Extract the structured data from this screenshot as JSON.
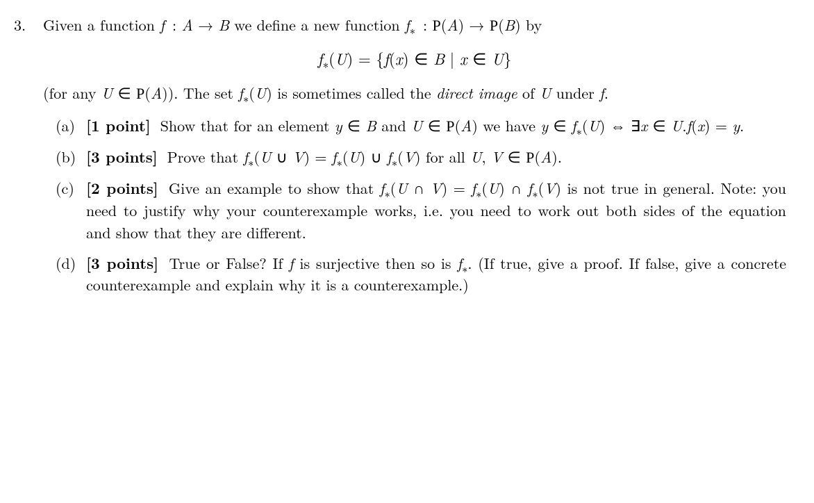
{
  "problem": {
    "number": "3.",
    "intro_html": "Given a function <span class='it'>f</span>&nbsp;: <span class='it'>A</span> → <span class='it'>B</span> we define a new function <span class='it'>f</span><span class='sub'>∗</span>&nbsp;: <span class='cal'>P</span>(<span class='it'>A</span>) → <span class='cal'>P</span>(<span class='it'>B</span>) by",
    "display_html": "<span class='it'>f</span><span class='sub'>∗</span>(<span class='it'>U</span>) = {<span class='it'>f</span>(<span class='it'>x</span>) ∈ <span class='it'>B</span> | <span class='it'>x</span> ∈ <span class='it'>U</span>}",
    "after_html": "(for any <span class='it'>U</span> ∈ <span class='cal'>P</span>(<span class='it'>A</span>)). The set <span class='it'>f</span><span class='sub'>∗</span>(<span class='it'>U</span>) is sometimes called the <span class='it'>direct image</span> of <span class='it'>U</span> under <span class='it'>f</span>.",
    "parts": [
      {
        "label": "(a)",
        "points": "[1 point]",
        "text_html": "Show that for an element <span class='it'>y</span> ∈ <span class='it'>B</span> and <span class='it'>U</span> ∈ <span class='cal'>P</span>(<span class='it'>A</span>) we have <span class='it'>y</span> ∈ <span class='it'>f</span><span class='sub'>∗</span>(<span class='it'>U</span>) ⇔ ∃<span class='it'>x</span> ∈ <span class='it'>U</span>.<span class='it'>f</span>(<span class='it'>x</span>) = <span class='it'>y</span>."
      },
      {
        "label": "(b)",
        "points": "[3 points]",
        "text_html": "Prove that <span class='it'>f</span><span class='sub'>∗</span>(<span class='it'>U</span> ∪ <span class='it'>V</span>) = <span class='it'>f</span><span class='sub'>∗</span>(<span class='it'>U</span>) ∪ <span class='it'>f</span><span class='sub'>∗</span>(<span class='it'>V</span>) for all <span class='it'>U</span>, <span class='it'>V</span> ∈ <span class='cal'>P</span>(<span class='it'>A</span>)."
      },
      {
        "label": "(c)",
        "points": "[2 points]",
        "text_html": "Give an example to show that <span class='it'>f</span><span class='sub'>∗</span>(<span class='it'>U</span> ∩ <span class='it'>V</span>) = <span class='it'>f</span><span class='sub'>∗</span>(<span class='it'>U</span>) ∩ <span class='it'>f</span><span class='sub'>∗</span>(<span class='it'>V</span>) is not true in general. Note: you need to justify why your counterexample works, i.e. you need to work out both sides of the equation and show that they are different."
      },
      {
        "label": "(d)",
        "points": "[3 points]",
        "text_html": "True or False? If <span class='it'>f</span> is surjective then so is <span class='it'>f</span><span class='sub'>∗</span>. (If true, give a proof. If false, give a concrete counterexample and explain why it is a counterexample.)"
      }
    ]
  }
}
